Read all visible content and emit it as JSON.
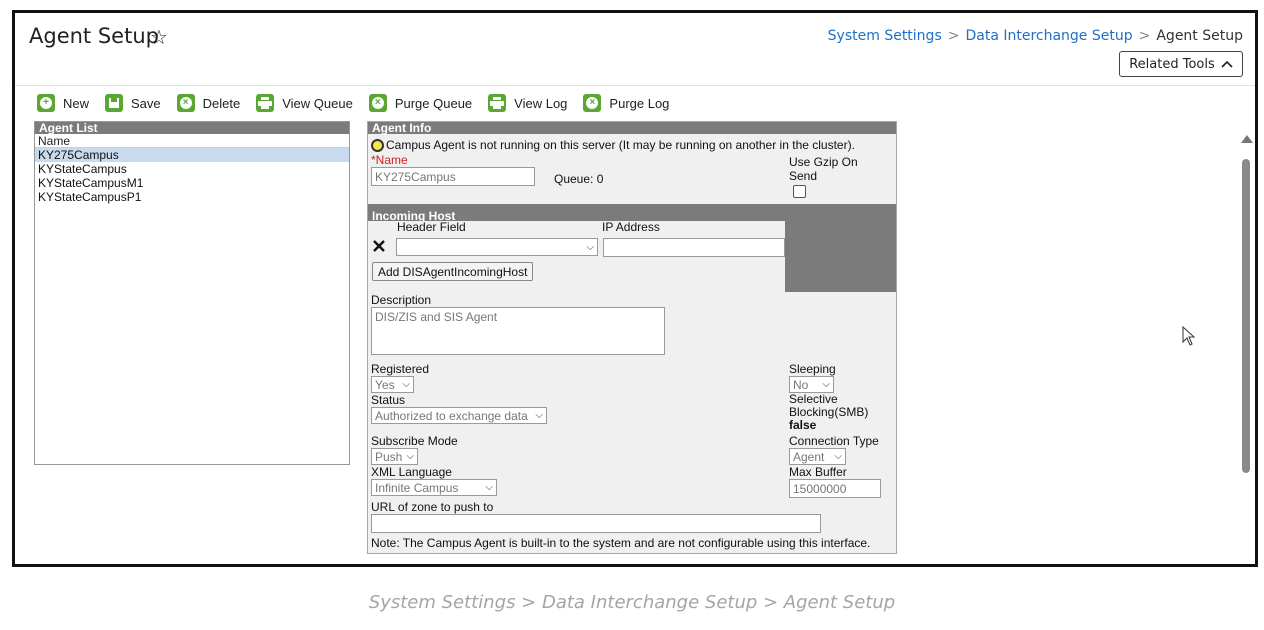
{
  "header": {
    "title": "Agent Setup",
    "star_icon": "star-outline-icon",
    "breadcrumb": [
      "System Settings",
      "Data Interchange Setup",
      "Agent Setup"
    ],
    "breadcrumb_sep": ">",
    "related_tools_label": "Related Tools",
    "related_tools_icon": "chevron-up-icon"
  },
  "toolbar": {
    "new": "New",
    "save": "Save",
    "delete": "Delete",
    "view_queue": "View Queue",
    "purge_queue": "Purge Queue",
    "view_log": "View Log",
    "purge_log": "Purge Log",
    "accent_color": "#5aa833"
  },
  "agent_list": {
    "title": "Agent List",
    "column": "Name",
    "items": [
      "KY275Campus",
      "KYStateCampus",
      "KYStateCampusM1",
      "KYStateCampusP1"
    ],
    "selected_index": 0
  },
  "agent_info": {
    "title": "Agent Info",
    "status_message": "Campus Agent is not running on this server (It may be running on another in the cluster).",
    "name_label": "*Name",
    "name_value": "KY275Campus",
    "queue_label": "Queue: 0",
    "gzip_label_1": "Use Gzip On",
    "gzip_label_2": "Send",
    "incoming_host": {
      "title": "Incoming Host",
      "header_field_label": "Header Field",
      "ip_address_label": "IP Address",
      "add_button": "Add DISAgentIncomingHost"
    },
    "description_label": "Description",
    "description_value": "DIS/ZIS and SIS Agent",
    "registered_label": "Registered",
    "registered_value": "Yes",
    "sleeping_label": "Sleeping",
    "sleeping_value": "No",
    "status_label": "Status",
    "status_value": "Authorized to exchange data",
    "smb_label_1": "Selective",
    "smb_label_2": "Blocking(SMB)",
    "smb_value": "false",
    "subscribe_label": "Subscribe Mode",
    "subscribe_value": "Push",
    "connection_label": "Connection Type",
    "connection_value": "Agent",
    "xml_label": "XML Language",
    "xml_value": "Infinite Campus",
    "max_buffer_label": "Max Buffer",
    "max_buffer_value": "15000000",
    "url_label": "URL of zone to push to",
    "url_value": "",
    "note": "Note: The Campus Agent is built-in to the system and are not configurable using this interface."
  },
  "caption": "System Settings > Data Interchange Setup > Agent Setup"
}
